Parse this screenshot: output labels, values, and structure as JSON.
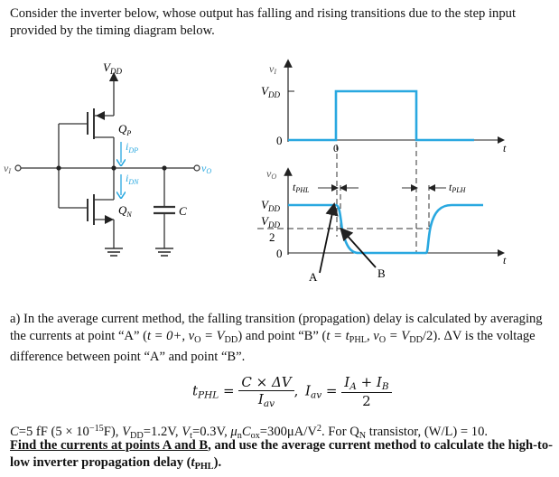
{
  "intro": "Consider the inverter below, whose output has falling and rising transitions due to the step input provided by the timing diagram below.",
  "circuit": {
    "vdd_label": "V",
    "vdd_sub": "DD",
    "qp_label": "Q",
    "qp_sub": "P",
    "qn_label": "Q",
    "qn_sub": "N",
    "idp_label": "i",
    "idp_sub": "DP",
    "idn_label": "i",
    "idn_sub": "DN",
    "vi_label": "v",
    "vi_sub": "I",
    "vo_label": "v",
    "vo_sub": "O",
    "cap_label": "C",
    "current_color": "#29a8e0"
  },
  "timing": {
    "input_axis_label": "v",
    "input_axis_sub": "I",
    "input_vdd": "V",
    "input_vdd_sub": "DD",
    "input_zero": "0",
    "input_t_zero": "0",
    "input_t_label": "t",
    "output_axis_label": "v",
    "output_axis_sub": "O",
    "output_vdd": "V",
    "output_vdd_sub": "DD",
    "output_half_num": "V",
    "output_half_num_sub": "DD",
    "output_half_den": "2",
    "output_zero": "0",
    "output_t_label": "t",
    "tphl_label": "t",
    "tphl_sub": "PHL",
    "tplh_label": "t",
    "tplh_sub": "PLH",
    "point_a": "A",
    "point_b": "B",
    "wave_color": "#29a8e0"
  },
  "part_a": {
    "prefix": "a) In the average current method, the falling transition (propagation) delay is calculated by averaging the currents at point “A” (",
    "cond_a": "t = 0+, v",
    "cond_a_sub": "O",
    "cond_a_end": " = V",
    "cond_a_end_sub": "DD",
    "mid": ") and point “B” (",
    "cond_b": "t = t",
    "cond_b_sub": "PHL",
    "cond_b_mid": ", v",
    "cond_b_mid_sub": "O",
    "cond_b_end": " = V",
    "cond_b_end_sub": "DD",
    "cond_b_tail": "/2",
    "suffix": "). ΔV is the voltage difference between point “A” and point “B”."
  },
  "formula": {
    "tphl_lhs": "t",
    "tphl_lhs_sub": "PHL",
    "eq": "=",
    "num1": "C × ΔV",
    "den1": "I",
    "den1_sub": "av",
    "comma": ",",
    "iav_lhs": "I",
    "iav_lhs_sub": "av",
    "num2_a": "I",
    "num2_a_sub": "A",
    "num2_plus": " + ",
    "num2_b": "I",
    "num2_b_sub": "B",
    "den2": "2"
  },
  "givens": {
    "c": "C",
    "c_val": "=5 fF (5 × 10",
    "c_exp": "−15",
    "c_unit": "F), ",
    "vdd": "V",
    "vdd_sub": "DD",
    "vdd_val": "=1.2V, ",
    "vt": "V",
    "vt_sub": "t",
    "vt_val": "=0.3V, ",
    "mu": "μ",
    "mu_sub": "n",
    "cox": "C",
    "cox_sub": "ox",
    "mu_val": "=300μA/V",
    "mu_exp": "2",
    "qn_text": ". For Q",
    "qn_sub": "N",
    "wl_text": " transistor, (W/L) = 10."
  },
  "task": {
    "underlined": "Find the currents at points A and B",
    "rest": ", and use the average current method to calculate the high-to-low inverter propagation delay (",
    "t": "t",
    "t_sub": "PHL",
    "end": ")."
  }
}
